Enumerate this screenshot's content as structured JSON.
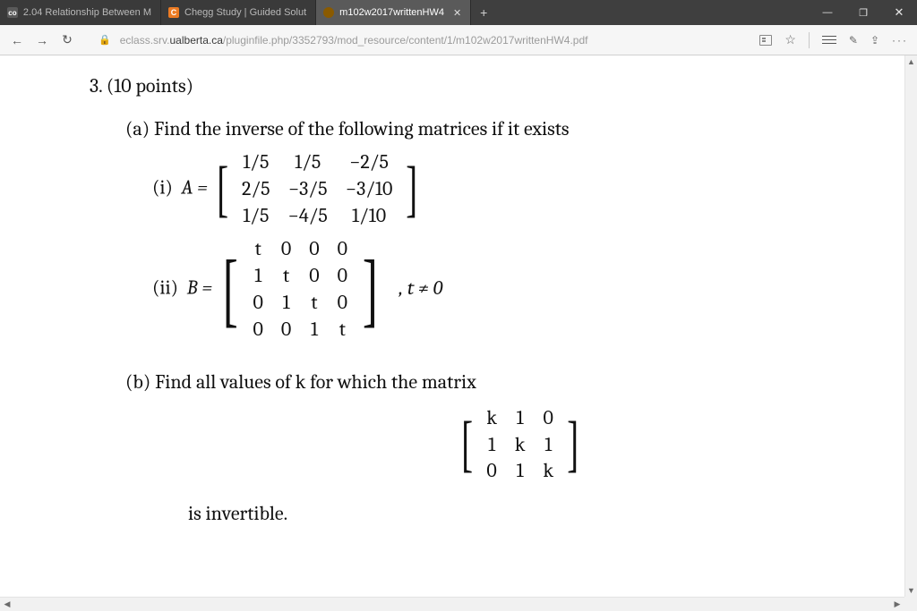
{
  "tabs": [
    {
      "label": "2.04 Relationship Between M",
      "favicon": "co"
    },
    {
      "label": "Chegg Study | Guided Solut",
      "favicon": "C"
    },
    {
      "label": "m102w2017writtenHW4",
      "favicon": "pdf",
      "active": true
    }
  ],
  "window_controls": {
    "minimize": "—",
    "maximize": "❐",
    "close": "✕"
  },
  "toolbar": {
    "back": "←",
    "forward": "→",
    "refresh": "↻",
    "lock": "🔒",
    "url_prefix": "eclass.srv.",
    "url_domain": "ualberta.ca",
    "url_path": "/pluginfile.php/3352793/mod_resource/content/1/m102w2017writtenHW4.pdf",
    "star": "☆",
    "share": "⇪",
    "more": "···",
    "pen": "✎"
  },
  "document": {
    "q_number": "3.",
    "q_points": "(10 points)",
    "part_a_label": "(a)",
    "part_a_text": "Find the inverse of the following matrices if it exists",
    "sub_i_label": "(i)",
    "sub_i_lhs": "A =",
    "matrix_A": [
      [
        "1/5",
        "1/5",
        "−2/5"
      ],
      [
        "2/5",
        "−3/5",
        "−3/10"
      ],
      [
        "1/5",
        "−4/5",
        "1/10"
      ]
    ],
    "sub_ii_label": "(ii)",
    "sub_ii_lhs": "B =",
    "matrix_B": [
      [
        "t",
        "0",
        "0",
        "0"
      ],
      [
        "1",
        "t",
        "0",
        "0"
      ],
      [
        "0",
        "1",
        "t",
        "0"
      ],
      [
        "0",
        "0",
        "1",
        "t"
      ]
    ],
    "sub_ii_cond": ",  t ≠ 0",
    "part_b_label": "(b)",
    "part_b_text": "Find all values of k for which the matrix",
    "matrix_K": [
      [
        "k",
        "1",
        "0"
      ],
      [
        "1",
        "k",
        "1"
      ],
      [
        "0",
        "1",
        "k"
      ]
    ],
    "part_b_tail": "is invertible."
  }
}
